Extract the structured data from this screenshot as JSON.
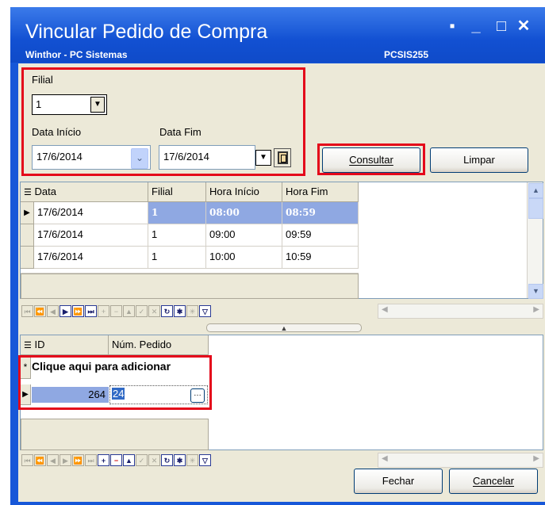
{
  "window": {
    "title": "Vincular Pedido de Compra",
    "subtitle": "Winthor - PC Sistemas",
    "form_code": "PCSIS255",
    "controls": [
      "▪",
      "_",
      "□",
      "✕"
    ]
  },
  "filter": {
    "filial_label": "Filial",
    "filial_value": "1",
    "start_label": "Data Início",
    "start_value": "17/6/2014",
    "end_label": "Data Fim",
    "end_value": "17/6/2014"
  },
  "buttons": {
    "consultar": "Consultar",
    "limpar": "Limpar",
    "fechar": "Fechar",
    "cancelar": "Cancelar"
  },
  "schedule_grid": {
    "columns": [
      "Data",
      "Filial",
      "Hora Início",
      "Hora Fim"
    ],
    "rows": [
      {
        "data": "17/6/2014",
        "filial": "1",
        "inicio": "08:00",
        "fim": "08:59"
      },
      {
        "data": "17/6/2014",
        "filial": "1",
        "inicio": "09:00",
        "fim": "09:59"
      },
      {
        "data": "17/6/2014",
        "filial": "1",
        "inicio": "10:00",
        "fim": "10:59"
      }
    ]
  },
  "orders_grid": {
    "columns": [
      "ID",
      "Núm. Pedido"
    ],
    "new_row_text": "Clique aqui para adicionar",
    "rows": [
      {
        "id": "264",
        "pedido": "24"
      }
    ]
  },
  "colors": {
    "titlebar": "#1757d8",
    "highlight": "#e4071a",
    "selected_row": "#8fa8e2"
  }
}
